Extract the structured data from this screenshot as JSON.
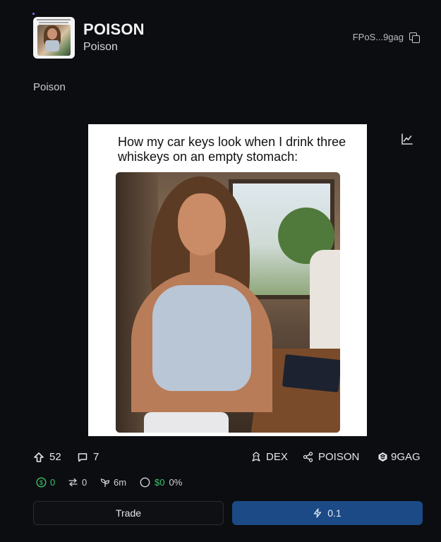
{
  "token": {
    "name": "POISON",
    "ticker": "Poison",
    "address": "FPoS...9gag",
    "description": "Poison"
  },
  "meme": {
    "caption": "How my car keys look when I drink three whiskeys on an empty stomach:"
  },
  "stats": {
    "upvotes": "52",
    "comments": "7",
    "dex_label": "DEX",
    "community_label": "POISON",
    "source_label": "9GAG"
  },
  "meta": {
    "fees": "0",
    "swaps": "0",
    "age": "6m",
    "volume": "$0",
    "percent": "0%"
  },
  "actions": {
    "trade_label": "Trade",
    "buy_amount": "0.1"
  },
  "colors": {
    "background": "#0c0d10",
    "buy_button": "#1b4a86",
    "positive": "#38c46b"
  },
  "icons": [
    "copy-icon",
    "chart-icon",
    "upvote-icon",
    "comment-icon",
    "dex-icon",
    "share-icon",
    "9gag-icon",
    "dollar-icon",
    "swap-icon",
    "sprout-icon",
    "circle-icon",
    "lightning-icon"
  ]
}
